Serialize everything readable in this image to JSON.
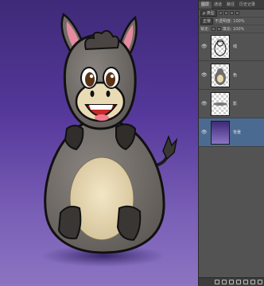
{
  "panel": {
    "tabs": [
      "图层",
      "通道",
      "路径",
      "历史记录",
      "属性"
    ],
    "filter_label": "ρ 类型",
    "blend_mode": "正常",
    "opacity_label": "不透明度: 100%",
    "lock_label": "锁定:",
    "fill_label": "填充: 100%",
    "layers": [
      {
        "name": "线",
        "visible": true
      },
      {
        "name": "色",
        "visible": true
      },
      {
        "name": "影",
        "visible": true
      },
      {
        "name": "背景",
        "visible": true,
        "selected": true
      }
    ]
  },
  "colors": {
    "canvas_top": "#3e2a78",
    "canvas_bottom": "#8c74c2",
    "donkey_body": "#716c68",
    "donkey_belly": "#e7d8ae",
    "panel_bg": "#535353",
    "selection": "#4b6a92"
  }
}
